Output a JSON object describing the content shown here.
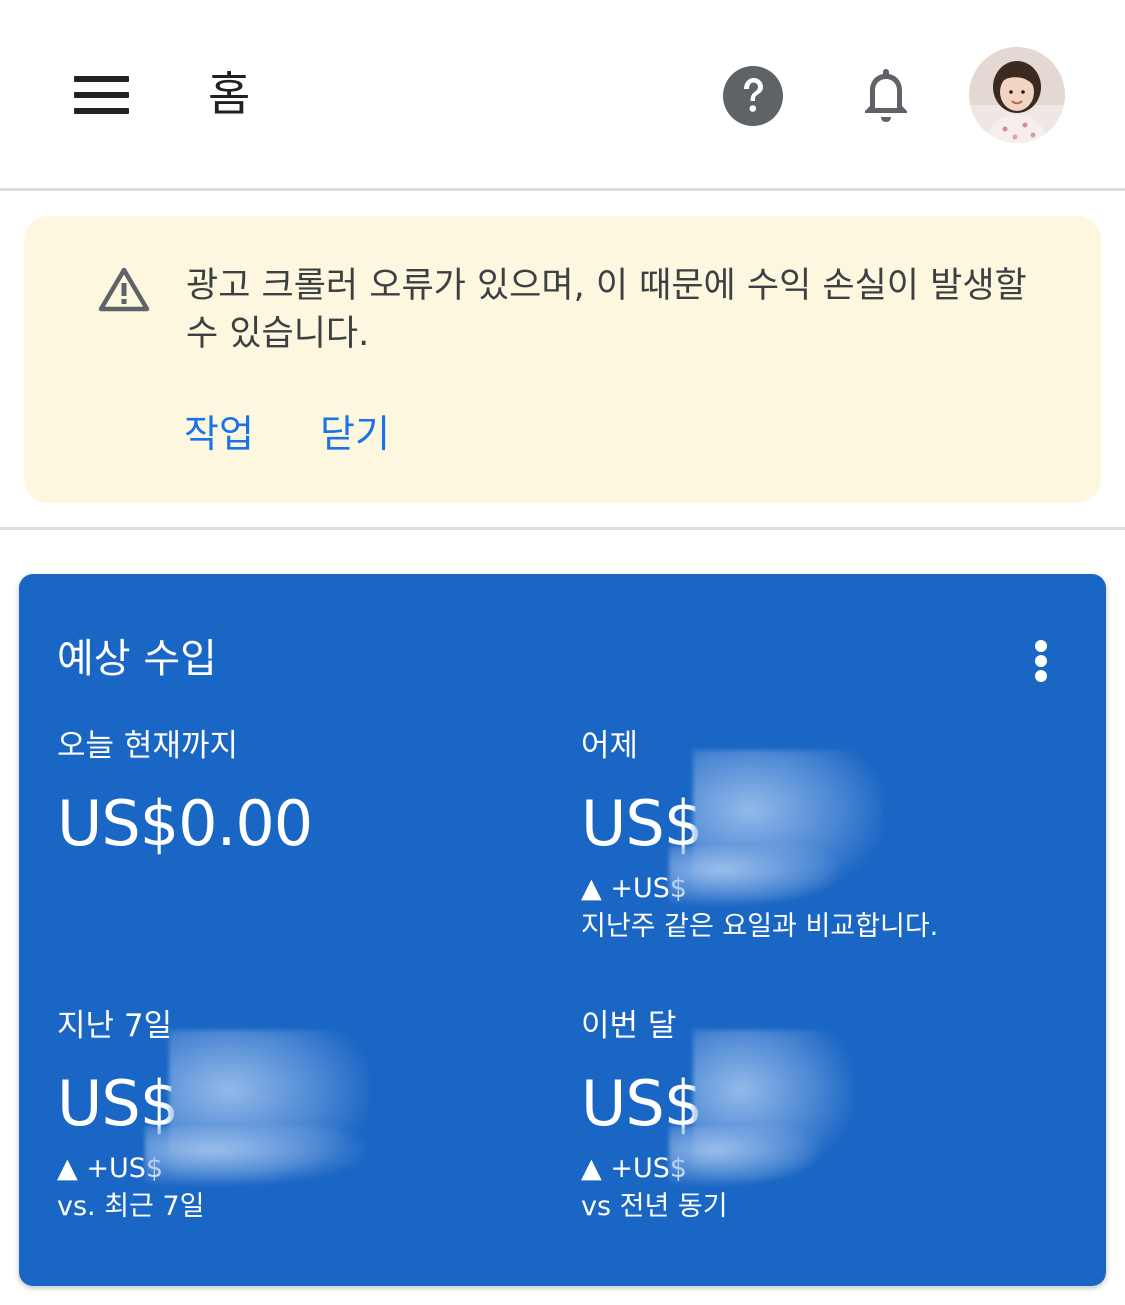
{
  "app_bar": {
    "title": "홈",
    "menu_icon": "hamburger-menu-icon",
    "help_icon": "help-circle-icon",
    "notifications_icon": "bell-icon",
    "avatar_icon": "user-avatar"
  },
  "banner": {
    "icon": "warning-triangle-icon",
    "message": "광고 크롤러 오류가 있으며, 이 때문에 수익 손실이 발생할 수 있습니다.",
    "actions": [
      "작업",
      "닫기"
    ],
    "background": "#fef7e0",
    "action_color": "#1a73e8"
  },
  "earnings_card": {
    "title": "예상 수입",
    "menu_icon": "more-vert-icon",
    "background": "#1a66c4",
    "metrics": [
      {
        "label": "오늘 현재까지",
        "value": "US$0.00",
        "change": "",
        "compare": ""
      },
      {
        "label": "어제",
        "value": "US$",
        "change": "▲ +US$",
        "compare": "지난주 같은 요일과 비교합니다."
      },
      {
        "label": "지난 7일",
        "value": "US$",
        "change": "▲ +US$",
        "compare": "vs. 최근 7일"
      },
      {
        "label": "이번 달",
        "value": "US$",
        "change": "▲ +US$",
        "compare": "vs 전년 동기"
      }
    ]
  }
}
